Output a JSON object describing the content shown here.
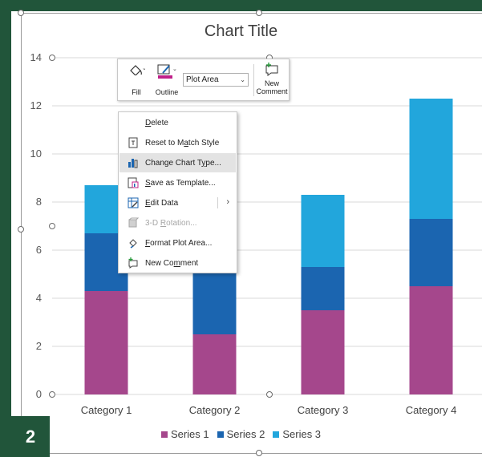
{
  "chart_data": {
    "type": "bar",
    "stacked": true,
    "title": "Chart Title",
    "categories": [
      "Category 1",
      "Category 2",
      "Category 3",
      "Category 4"
    ],
    "series": [
      {
        "name": "Series 1",
        "values": [
          4.3,
          2.5,
          3.5,
          4.5
        ],
        "color": "#a5478c"
      },
      {
        "name": "Series 2",
        "values": [
          2.4,
          4.4,
          1.8,
          2.8
        ],
        "color": "#1b65b0"
      },
      {
        "name": "Series 3",
        "values": [
          2.0,
          1.8,
          3.0,
          5.0
        ],
        "color": "#22a6dc"
      }
    ],
    "yticks": [
      "0",
      "2",
      "4",
      "6",
      "8",
      "10",
      "12",
      "14"
    ],
    "ylim": [
      0,
      14
    ],
    "grid": true,
    "legend": "bottom"
  },
  "badge": "2",
  "toolbar": {
    "fill_label": "Fill",
    "outline_label": "Outline",
    "selector_value": "Plot Area",
    "new_comment_line1": "New",
    "new_comment_line2": "Comment",
    "outline_color": "#c0208a"
  },
  "context_menu": {
    "items": [
      {
        "pre": "",
        "ul": "D",
        "post": "elete",
        "icon": "none-icon",
        "disabled": false
      },
      {
        "pre": "Reset to M",
        "ul": "a",
        "post": "tch Style",
        "icon": "reset-style-icon",
        "disabled": false
      },
      {
        "pre": "Change Chart T",
        "ul": "y",
        "post": "pe...",
        "icon": "change-chart-type-icon",
        "disabled": false,
        "hover": true
      },
      {
        "pre": "",
        "ul": "S",
        "post": "ave as Template...",
        "icon": "save-template-icon",
        "disabled": false
      },
      {
        "pre": "",
        "ul": "E",
        "post": "dit Data",
        "icon": "edit-data-icon",
        "disabled": false,
        "submenu": true
      },
      {
        "pre": "3-D ",
        "ul": "R",
        "post": "otation...",
        "icon": "3d-rotation-icon",
        "disabled": true
      },
      {
        "pre": "",
        "ul": "F",
        "post": "ormat Plot Area...",
        "icon": "format-plot-area-icon",
        "disabled": false
      },
      {
        "pre": "New Co",
        "ul": "m",
        "post": "ment",
        "icon": "new-comment-icon",
        "disabled": false
      }
    ]
  }
}
